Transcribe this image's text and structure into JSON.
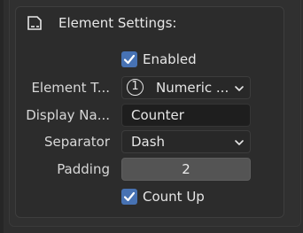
{
  "panel": {
    "title": "Element Settings:",
    "icon": "element-settings-icon"
  },
  "enabled": {
    "label": "Enabled",
    "checked": true
  },
  "element_type": {
    "label": "Element T...",
    "value": "Numeric ...",
    "badge": "1"
  },
  "display_name": {
    "label": "Display Na...",
    "value": "Counter"
  },
  "separator": {
    "label": "Separator",
    "value": "Dash"
  },
  "padding": {
    "label": "Padding",
    "value": "2"
  },
  "count_up": {
    "label": "Count Up",
    "checked": true
  },
  "colors": {
    "accent": "#4772b3",
    "background": "#2c2c2c",
    "field": "#1e1e1e",
    "number_field": "#545454"
  }
}
